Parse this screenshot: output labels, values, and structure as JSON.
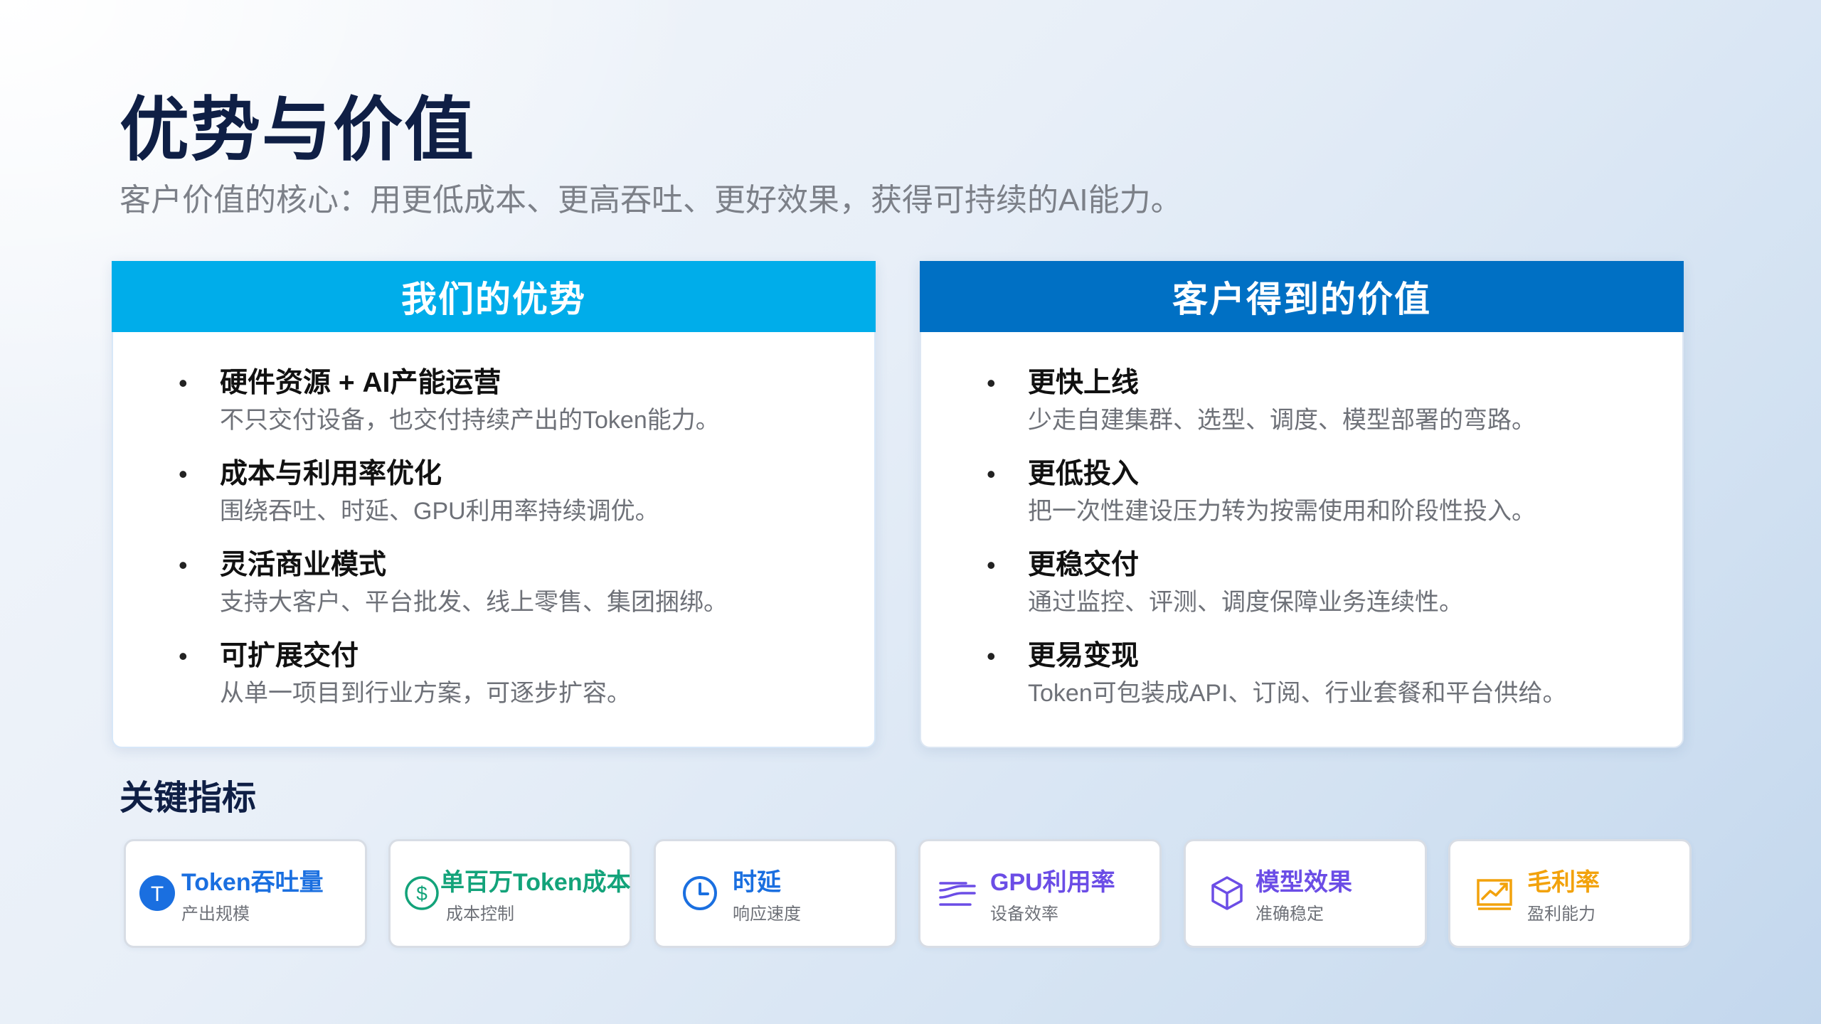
{
  "page": {
    "title": "优势与价值",
    "subtitle": "客户价值的核心：用更低成本、更高吞吐、更好效果，获得可持续的AI能力。"
  },
  "advantages": {
    "header": "我们的优势",
    "header_color": "#00adea",
    "items": [
      {
        "title": "硬件资源 + AI产能运营",
        "desc": "不只交付设备，也交付持续产出的Token能力。"
      },
      {
        "title": "成本与利用率优化",
        "desc": "围绕吞吐、时延、GPU利用率持续调优。"
      },
      {
        "title": "灵活商业模式",
        "desc": "支持大客户、平台批发、线上零售、集团捆绑。"
      },
      {
        "title": "可扩展交付",
        "desc": "从单一项目到行业方案，可逐步扩容。"
      }
    ]
  },
  "values": {
    "header": "客户得到的价值",
    "header_color": "#0070c4",
    "items": [
      {
        "title": "更快上线",
        "desc": "少走自建集群、选型、调度、模型部署的弯路。"
      },
      {
        "title": "更低投入",
        "desc": "把一次性建设压力转为按需使用和阶段性投入。"
      },
      {
        "title": "更稳交付",
        "desc": "通过监控、评测、调度保障业务连续性。"
      },
      {
        "title": "更易变现",
        "desc": "Token可包装成API、订阅、行业套餐和平台供给。"
      }
    ]
  },
  "bullet_symbol": "•",
  "metrics": {
    "title": "关键指标",
    "cards": [
      {
        "title": "Token吞吐量",
        "sub": "产出规模",
        "color": "#1a6fe0",
        "icon": "token-icon",
        "icon_letter": "T"
      },
      {
        "title": "单百万Token成本",
        "sub": "成本控制",
        "color": "#13a37a",
        "icon": "dollar-icon",
        "icon_letter": "$"
      },
      {
        "title": "时延",
        "sub": "响应速度",
        "color": "#1a6fe0",
        "icon": "clock-icon"
      },
      {
        "title": "GPU利用率",
        "sub": "设备效率",
        "color": "#6b4de6",
        "icon": "flow-lines-icon"
      },
      {
        "title": "模型效果",
        "sub": "准确稳定",
        "color": "#6b4de6",
        "icon": "cube-icon"
      },
      {
        "title": "毛利率",
        "sub": "盈利能力",
        "color": "#f2a20c",
        "icon": "trend-chart-icon"
      }
    ]
  }
}
